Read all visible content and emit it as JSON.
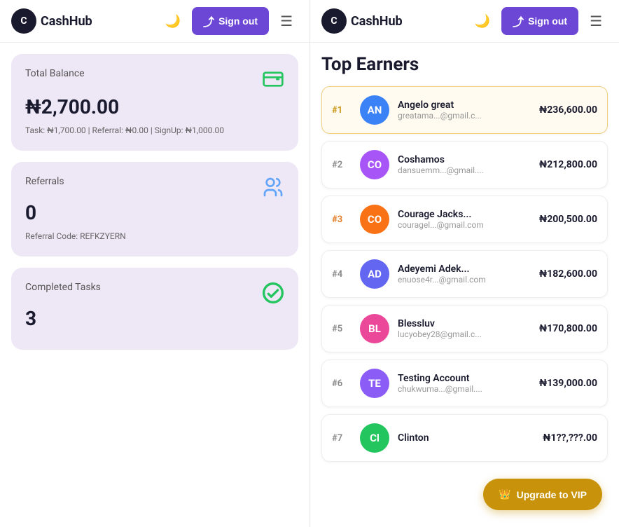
{
  "leftNav": {
    "logoInitial": "C",
    "appName": "CashHub",
    "moonIcon": "🌙",
    "signOutLabel": "Sign out",
    "menuIcon": "☰"
  },
  "rightNav": {
    "logoInitial": "C",
    "appName": "CashHub",
    "moonIcon": "🌙",
    "signOutLabel": "Sign out",
    "menuIcon": "☰"
  },
  "cards": {
    "balance": {
      "title": "Total Balance",
      "value": "₦2,700.00",
      "subtitle": "Task: ₦1,700.00 | Referral: ₦0.00 | SignUp: ₦1,000.00"
    },
    "referrals": {
      "title": "Referrals",
      "value": "0",
      "subtitle": "Referral Code: REFKZYERN"
    },
    "tasks": {
      "title": "Completed Tasks",
      "value": "3"
    }
  },
  "topEarners": {
    "sectionTitle": "Top Earners",
    "earners": [
      {
        "rank": "#1",
        "rankClass": "gold",
        "initials": "AN",
        "avatarColor": "#3b82f6",
        "name": "Angelo great",
        "email": "greatama...@gmail.c...",
        "amount": "₦236,600.00",
        "goldBorder": true
      },
      {
        "rank": "#2",
        "rankClass": "",
        "initials": "CO",
        "avatarColor": "#a855f7",
        "name": "Coshamos",
        "email": "dansuemm...@gmail....",
        "amount": "₦212,800.00",
        "goldBorder": false
      },
      {
        "rank": "#3",
        "rankClass": "orange",
        "initials": "CO",
        "avatarColor": "#f97316",
        "name": "Courage Jacks...",
        "email": "couragel...@gmail.com",
        "amount": "₦200,500.00",
        "goldBorder": false
      },
      {
        "rank": "#4",
        "rankClass": "",
        "initials": "AD",
        "avatarColor": "#6366f1",
        "name": "Adeyemi Adek...",
        "email": "enuose4r...@gmail.com",
        "amount": "₦182,600.00",
        "goldBorder": false
      },
      {
        "rank": "#5",
        "rankClass": "",
        "initials": "BL",
        "avatarColor": "#ec4899",
        "name": "Blessluv",
        "email": "lucyobey28@gmail.c...",
        "amount": "₦170,800.00",
        "goldBorder": false
      },
      {
        "rank": "#6",
        "rankClass": "",
        "initials": "TE",
        "avatarColor": "#8b5cf6",
        "name": "Testing Account",
        "email": "chukwuma...@gmail....",
        "amount": "₦139,000.00",
        "goldBorder": false
      },
      {
        "rank": "#7",
        "rankClass": "",
        "initials": "Cl",
        "avatarColor": "#22c55e",
        "name": "Clinton",
        "email": "",
        "amount": "₦1??,???.00",
        "goldBorder": false
      }
    ]
  },
  "upgradeBtn": {
    "label": "Upgrade to VIP",
    "icon": "👑"
  }
}
